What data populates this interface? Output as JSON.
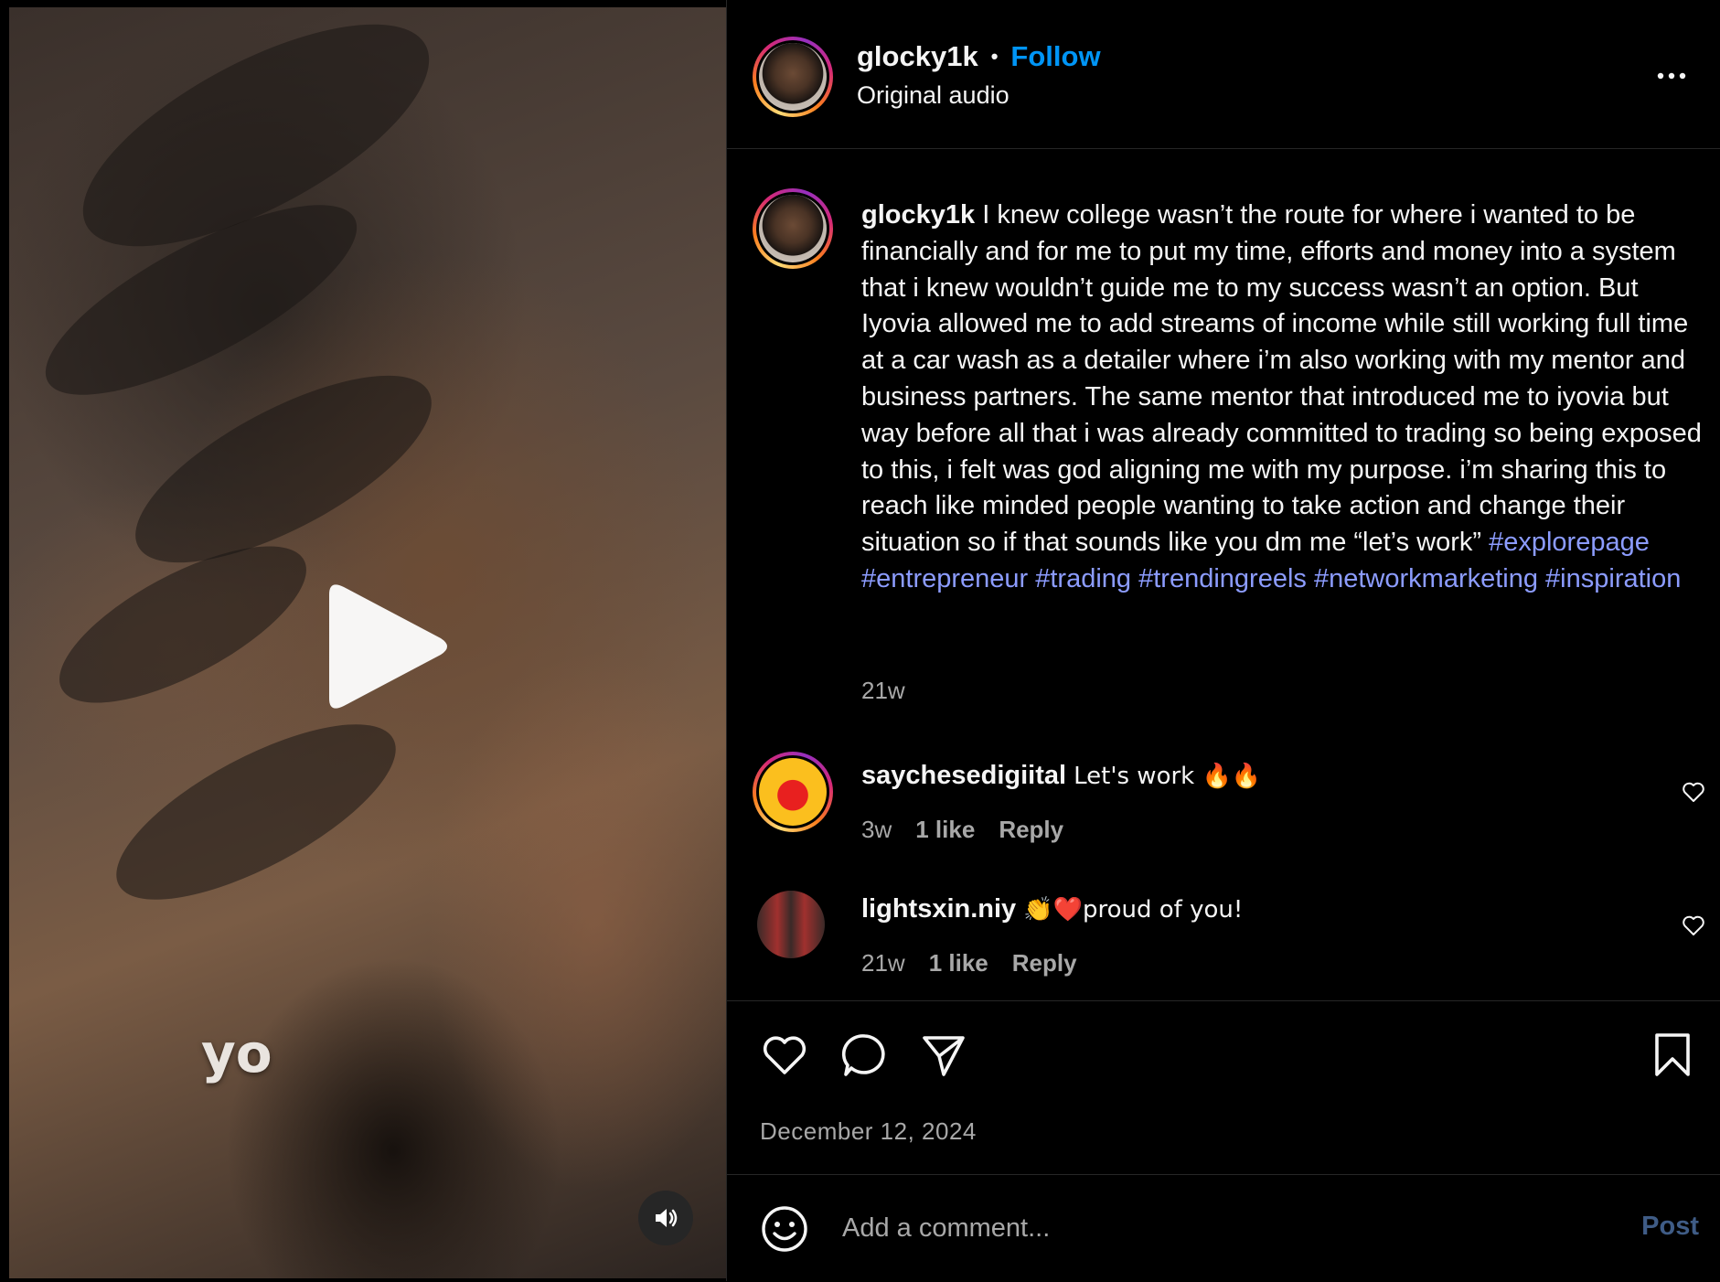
{
  "video": {
    "caption_overlay": "yo",
    "play_icon": "play-icon",
    "sound_icon": "speaker-icon"
  },
  "header": {
    "username": "glocky1k",
    "separator": "•",
    "follow_label": "Follow",
    "audio_label": "Original audio",
    "more_icon": "more-options-icon"
  },
  "caption": {
    "username": "glocky1k",
    "text": "I knew college wasn’t the route for where i wanted to be financially and for me to put my time, efforts and money into a system that i knew wouldn’t guide me to my success wasn’t an option. But Iyovia allowed me to add streams of income while still working full time at a car wash as a detailer where i’m also working with my mentor and business partners. The same mentor that introduced me to iyovia but way before all that i was already committed to trading so being exposed to this, i felt was god aligning me with my purpose. i’m sharing this to reach like minded people wanting to take action and change their situation so if that sounds like you dm me “let’s work”",
    "hashtags": [
      "#explorepage",
      "#entrepreneur",
      "#trading",
      "#trendingreels",
      "#networkmarketing",
      "#inspiration"
    ],
    "time": "21w"
  },
  "comments": [
    {
      "username": "saychesedigiital",
      "text": "Let's work 🔥🔥",
      "time": "3w",
      "likes": "1 like",
      "reply_label": "Reply"
    },
    {
      "username": "lightsxin.niy",
      "text": "👏❤️proud of you!",
      "time": "21w",
      "likes": "1 like",
      "reply_label": "Reply"
    }
  ],
  "actions": {
    "like_icon": "heart-icon",
    "comment_icon": "comment-icon",
    "share_icon": "share-icon",
    "save_icon": "bookmark-icon"
  },
  "post_date": "December 12, 2024",
  "comment_box": {
    "placeholder": "Add a comment...",
    "value": "",
    "post_label": "Post",
    "emoji_icon": "smiley-icon"
  },
  "colors": {
    "background": "#000000",
    "link_blue": "#0095f6",
    "hashtag": "#8c9cff",
    "muted": "#a8a8a8",
    "post_disabled": "#3f5c86"
  }
}
